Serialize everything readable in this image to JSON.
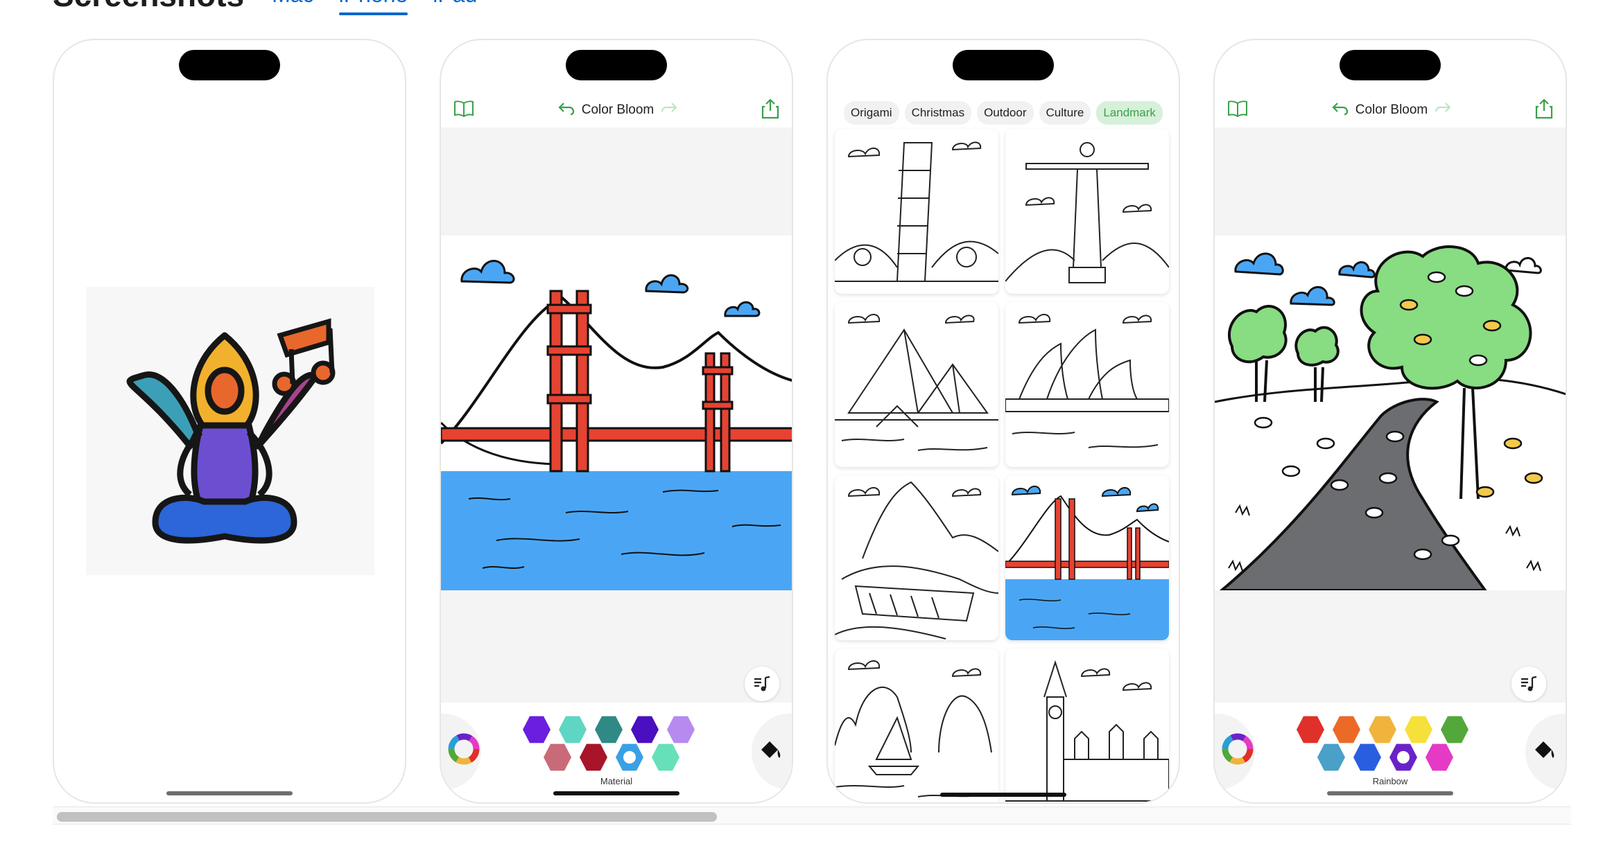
{
  "header": {
    "title": "Screenshots",
    "tabs": [
      {
        "label": "Mac",
        "active": false
      },
      {
        "label": "iPhone",
        "active": true
      },
      {
        "label": "iPad",
        "active": false
      }
    ]
  },
  "phone2": {
    "title": "Color Bloom",
    "palette_name": "Material",
    "palette_colors": [
      "#6a1ee0",
      "#5fd6c4",
      "#2f8a86",
      "#4a0fc0",
      "#b78af0",
      "#c96a78",
      "#a8152a",
      "#3aa0e6",
      "#66e0b8"
    ],
    "selected_index": 7
  },
  "phone3": {
    "categories": [
      {
        "label": "Origami",
        "active": false
      },
      {
        "label": "Christmas",
        "active": false
      },
      {
        "label": "Outdoor",
        "active": false
      },
      {
        "label": "Culture",
        "active": false
      },
      {
        "label": "Landmark",
        "active": true
      }
    ]
  },
  "phone4": {
    "title": "Color Bloom",
    "palette_name": "Rainbow",
    "palette_colors": [
      "#e0302a",
      "#ec6a28",
      "#f0b43c",
      "#f6e03a",
      "#52a83a",
      "#4aa0c8",
      "#2a5ee0",
      "#6a22c8",
      "#e43ac6"
    ],
    "selected_index": 7
  },
  "colors": {
    "accent_blue": "#0066cc",
    "accent_green": "#3aa14a"
  }
}
